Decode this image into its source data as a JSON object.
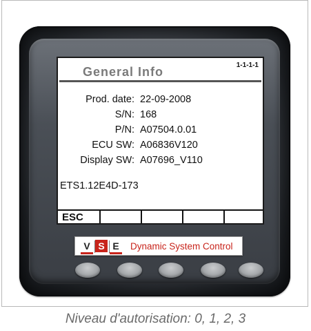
{
  "screen": {
    "title": "General Info",
    "code": "1-1-1-1",
    "rows": [
      {
        "label": "Prod. date:",
        "value": "22-09-2008"
      },
      {
        "label": "S/N:",
        "value": "168"
      },
      {
        "label": "P/N:",
        "value": "A07504.0.01"
      },
      {
        "label": "ECU SW:",
        "value": "A06836V120"
      },
      {
        "label": "Display SW:",
        "value": "A07696_V110"
      }
    ],
    "ets": "ETS1.12E4D-173",
    "softkeys": [
      "ESC",
      "",
      "",
      "",
      ""
    ]
  },
  "brand": {
    "letters": [
      "V",
      "S",
      "E"
    ],
    "name": "Dynamic System Control",
    "accent_color": "#c8241b"
  },
  "hardware_buttons": 5,
  "caption": "Niveau d'autorisation: 0, 1, 2, 3"
}
